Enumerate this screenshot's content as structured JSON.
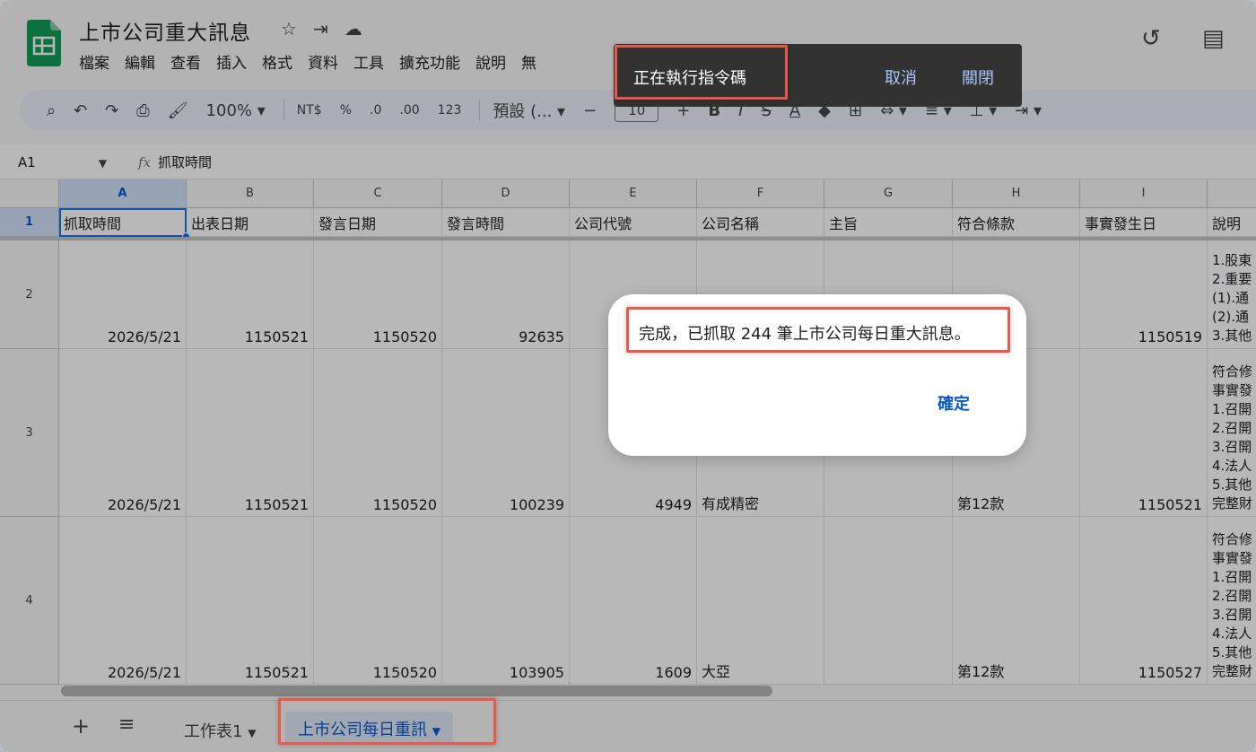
{
  "app": {
    "doc_title": "上市公司重大訊息",
    "menu": [
      "檔案",
      "編輯",
      "查看",
      "插入",
      "格式",
      "資料",
      "工具",
      "擴充功能",
      "說明",
      "無"
    ]
  },
  "toolbar": {
    "zoom": "100%",
    "currency": "NT$",
    "percent": "%",
    "dec_decrease": ".0",
    "dec_increase": ".00",
    "number_format": "123",
    "font": "預設 (...",
    "font_size": "10"
  },
  "formula_bar": {
    "cell_ref": "A1",
    "fx": "fx",
    "content": "抓取時間"
  },
  "columns": [
    "A",
    "B",
    "C",
    "D",
    "E",
    "F",
    "G",
    "H",
    "I",
    ""
  ],
  "rows": [
    {
      "num": "1",
      "cells": [
        "抓取時間",
        "出表日期",
        "發言日期",
        "發言時間",
        "公司代號",
        "公司名稱",
        "主旨",
        "符合條款",
        "事實發生日",
        "說明"
      ]
    },
    {
      "num": "2",
      "cells": [
        "2026/5/21",
        "1150521",
        "1150520",
        "92635",
        "",
        "",
        "",
        "",
        "1150519"
      ],
      "desc": [
        "1.股東",
        "2.重要",
        "(1).通",
        "(2).通",
        "3.其他"
      ]
    },
    {
      "num": "3",
      "cells": [
        "2026/5/21",
        "1150521",
        "1150520",
        "100239",
        "4949",
        "有成精密",
        "",
        "第12款",
        "1150521"
      ],
      "desc": [
        "符合修",
        "事實發",
        "1.召開",
        "2.召開",
        "3.召開",
        "4.法人",
        "5.其他",
        "完整財"
      ]
    },
    {
      "num": "4",
      "cells": [
        "2026/5/21",
        "1150521",
        "1150520",
        "103905",
        "1609",
        "大亞",
        "",
        "第12款",
        "1150527"
      ],
      "desc": [
        "符合修",
        "事實發",
        "1.召開",
        "2.召開",
        "3.召開",
        "4.法人",
        "5.其他",
        "完整財"
      ]
    }
  ],
  "sheets": {
    "add": "+",
    "list": "≡",
    "tab1": "工作表1",
    "tab2": "上市公司每日重訊"
  },
  "snackbar": {
    "message": "正在執行指令碼",
    "cancel": "取消",
    "close": "關閉"
  },
  "dialog": {
    "message": "完成，已抓取 244 筆上市公司每日重大訊息。",
    "ok": "確定"
  },
  "colors": {
    "highlight": "#e8594a",
    "accent": "#0b57d0",
    "sheets_green": "#0f9d58"
  }
}
